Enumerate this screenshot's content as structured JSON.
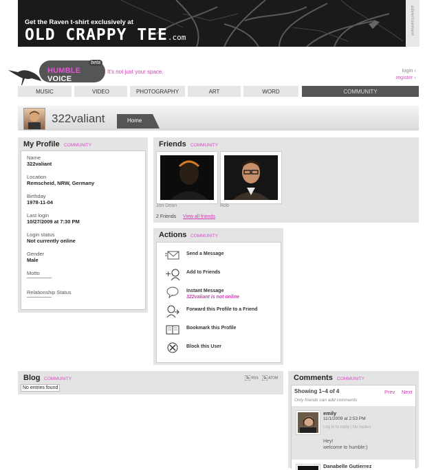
{
  "banner": {
    "line1": "Get the Raven t-shirt exclusively at",
    "brand": "OLD CRAPPY TEE",
    "brand_suffix": ".com",
    "ad_label": "advertisement"
  },
  "logo": {
    "name_a": "HUMBLE",
    "name_b": "VOICE",
    "beta": "beta",
    "tagline": "It's not just your space."
  },
  "auth": {
    "login": "login",
    "register": "register"
  },
  "nav": [
    "MUSIC",
    "VIDEO",
    "PHOTOGRAPHY",
    "ART",
    "WORD",
    "COMMUNITY"
  ],
  "header": {
    "username": "322valiant",
    "home_tab": "Home"
  },
  "profile": {
    "title": "My Profile",
    "tag": "COMMUNITY",
    "fields": [
      {
        "label": "Name",
        "value": "322valiant"
      },
      {
        "label": "Location",
        "value": "Remscheid, NRW, Germany"
      },
      {
        "label": "Birthday",
        "value": "1978-11-04"
      },
      {
        "label": "Last login",
        "value": "10/27/2009 at 7:30 PM"
      },
      {
        "label": "Login status",
        "value": "Not currently online"
      },
      {
        "label": "Gender",
        "value": "Male"
      },
      {
        "label": "Motto",
        "value": "——————"
      },
      {
        "label": "Relationship Status",
        "value": "——————"
      }
    ]
  },
  "friends": {
    "title": "Friends",
    "tag": "COMMUNITY",
    "list": [
      {
        "name": "Jon Dean"
      },
      {
        "name": "Rob"
      }
    ],
    "count": "2 Friends",
    "view_all": "View all friends"
  },
  "actions": {
    "title": "Actions",
    "tag": "COMMUNITY",
    "items": [
      {
        "label": "Send a Message",
        "icon": "envelope-icon"
      },
      {
        "label": "Add to Friends",
        "icon": "add-friend-icon"
      },
      {
        "label": "Instant Message",
        "sub": "322valiant is not online",
        "icon": "chat-bubble-icon"
      },
      {
        "label": "Forward this Profile to a Friend",
        "icon": "forward-icon"
      },
      {
        "label": "Bookmark this Profile",
        "icon": "book-icon"
      },
      {
        "label": "Block this User",
        "icon": "block-icon"
      }
    ]
  },
  "blog": {
    "title": "Blog",
    "tag": "COMMUNITY",
    "rss": "RSS",
    "atom": "ATOM",
    "empty": "No entries found"
  },
  "comments": {
    "title": "Comments",
    "tag": "COMMUNITY",
    "showing": "Showing 1–4 of 4",
    "prev": "Prev",
    "next": "Next",
    "note": "Only friends can add comments",
    "items": [
      {
        "author": "emily",
        "date": "11/1/2009 at 2:53 PM",
        "meta": "Log in to reply | No replies",
        "body1": "Hey!",
        "body2": "welcome to humble:)"
      },
      {
        "author": "Danabelle Gutierrez"
      }
    ]
  },
  "colors": {
    "accent": "#d13ab5",
    "nav_active": "#555555",
    "panel": "#e4e4e4"
  }
}
